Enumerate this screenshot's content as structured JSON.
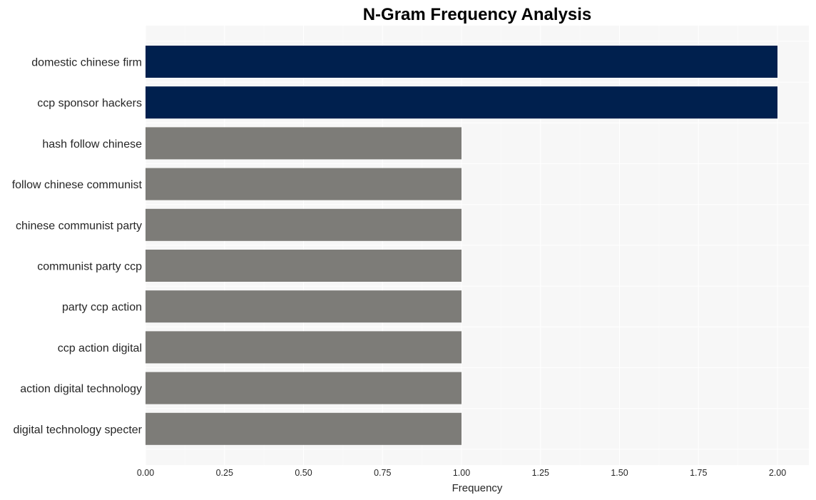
{
  "chart_data": {
    "type": "bar",
    "orientation": "horizontal",
    "title": "N-Gram Frequency Analysis",
    "xlabel": "Frequency",
    "ylabel": "",
    "xlim": [
      0,
      2.1
    ],
    "xticks": [
      "0.00",
      "0.25",
      "0.50",
      "0.75",
      "1.00",
      "1.25",
      "1.50",
      "1.75",
      "2.00"
    ],
    "xtick_values": [
      0,
      0.25,
      0.5,
      0.75,
      1.0,
      1.25,
      1.5,
      1.75,
      2.0
    ],
    "grid": true,
    "categories": [
      "domestic chinese firm",
      "ccp sponsor hackers",
      "hash follow chinese",
      "follow chinese communist",
      "chinese communist party",
      "communist party ccp",
      "party ccp action",
      "ccp action digital",
      "action digital technology",
      "digital technology specter"
    ],
    "values": [
      2,
      2,
      1,
      1,
      1,
      1,
      1,
      1,
      1,
      1
    ],
    "colors": {
      "highlight": "#00204e",
      "default": "#7d7c78",
      "plot_background": "#f7f7f7",
      "grid": "#ffffff"
    }
  }
}
